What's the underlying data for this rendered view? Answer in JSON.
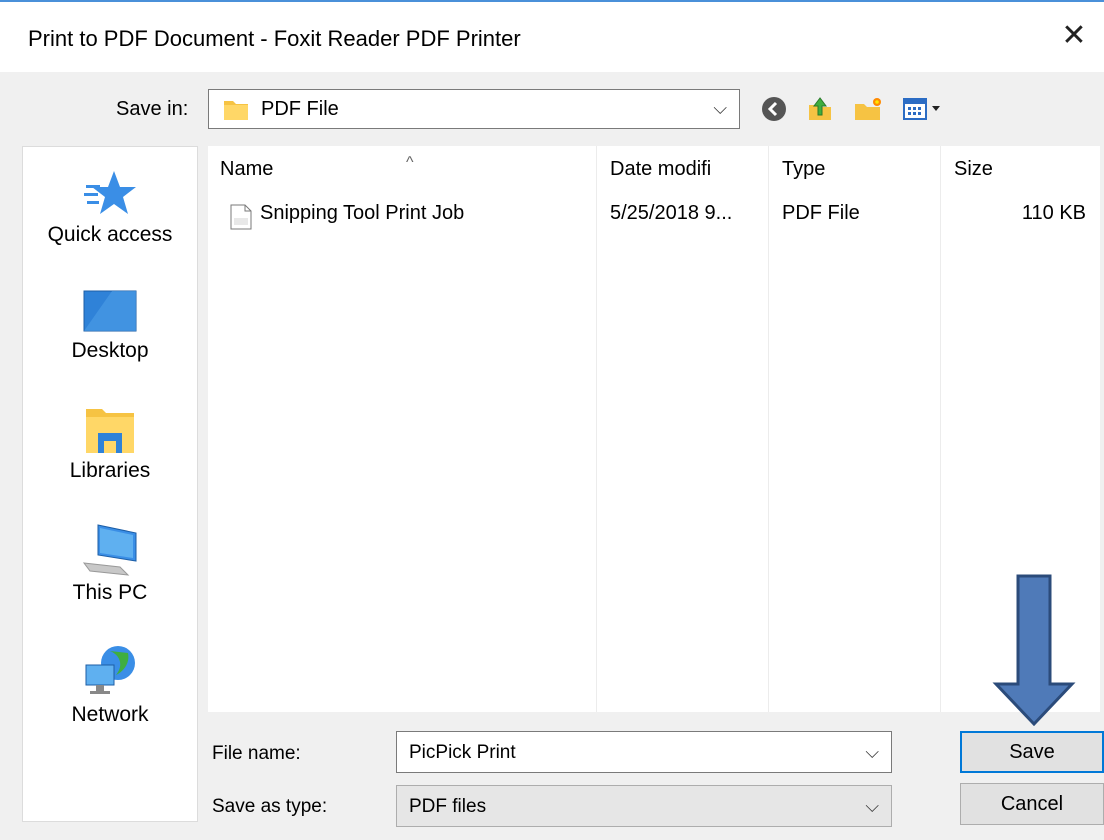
{
  "dialog": {
    "title": "Print to PDF Document - Foxit Reader PDF Printer",
    "close_glyph": "✕"
  },
  "save_in": {
    "label": "Save in:",
    "value": "PDF File",
    "chevron": "⌵"
  },
  "toolbar": {
    "icons": [
      "back-icon",
      "up-folder-icon",
      "new-folder-icon",
      "view-menu-icon"
    ]
  },
  "places": [
    {
      "label": "Quick access",
      "icon": "quick-access-star-icon"
    },
    {
      "label": "Desktop",
      "icon": "desktop-icon"
    },
    {
      "label": "Libraries",
      "icon": "libraries-icon"
    },
    {
      "label": "This PC",
      "icon": "this-pc-icon"
    },
    {
      "label": "Network",
      "icon": "network-icon"
    }
  ],
  "file_list": {
    "sort_indicator": "^",
    "columns": [
      "Name",
      "Date modifi",
      "Type",
      "Size"
    ],
    "rows": [
      {
        "name": "Snipping Tool Print Job",
        "date": "5/25/2018 9...",
        "type": "PDF File",
        "size": "110 KB",
        "icon": "pdf-file-icon"
      }
    ]
  },
  "file_name": {
    "label": "File name:",
    "value": "PicPick Print"
  },
  "save_as_type": {
    "label": "Save as type:",
    "value": "PDF files"
  },
  "buttons": {
    "save": "Save",
    "cancel": "Cancel"
  },
  "annotation": {
    "icon": "down-arrow-annotation-icon",
    "color": "#4f7ab8"
  },
  "colors": {
    "accent": "#0078d7",
    "folder": "#f6c343"
  }
}
